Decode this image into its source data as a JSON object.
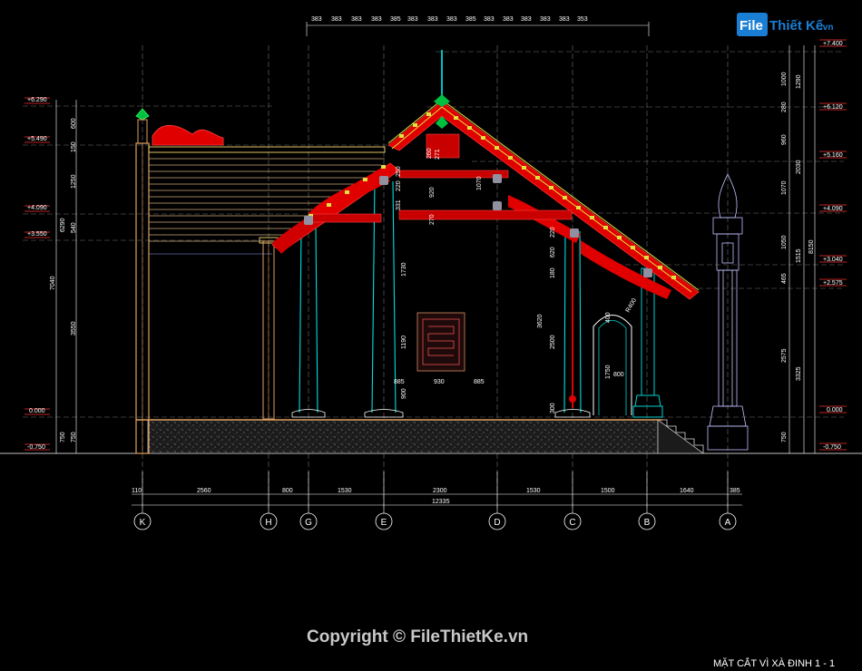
{
  "watermark": {
    "copyright": "Copyright © FileThietKe.vn",
    "logo_file": "File",
    "logo_rest": "Thiết Kế",
    "logo_domain": ".vn"
  },
  "drawing_title": "MẶT CẮT VÌ XÀ ĐINH 1 - 1",
  "top_dims": [
    "383",
    "383",
    "383",
    "383",
    "385",
    "383",
    "383",
    "383",
    "385",
    "383",
    "383",
    "383",
    "383",
    "383",
    "353"
  ],
  "left_levels": [
    "+6.290",
    "+5.490",
    "+4.090",
    "+3.550",
    "0.000",
    "-0.750"
  ],
  "right_levels": [
    "+7.400",
    "+6.120",
    "+5.160",
    "+4.090",
    "+3.040",
    "+2.575",
    "0.000",
    "-0.750"
  ],
  "left_dims_inner": [
    "600",
    "150",
    "1250",
    "540",
    "3550",
    "750"
  ],
  "left_dims_outer": [
    "6290",
    "7040",
    "750"
  ],
  "right_dims_inner": [
    "1000",
    "280",
    "960",
    "1070",
    "1050",
    "465",
    "2575",
    "750"
  ],
  "right_dims_outer": [
    "1290",
    "2030",
    "1515",
    "3325",
    "8150"
  ],
  "interior_dims": [
    "331",
    "220",
    "250",
    "260",
    "920",
    "271",
    "1070",
    "270",
    "1730",
    "1190",
    "885",
    "930",
    "885",
    "900",
    "620",
    "180",
    "220",
    "3620",
    "2500",
    "300",
    "400",
    "R400",
    "1750",
    "800"
  ],
  "bottom_dims": [
    "110",
    "2560",
    "800",
    "1530",
    "2300",
    "1530",
    "1500",
    "1640",
    "385"
  ],
  "bottom_total": "12335",
  "axes": [
    "K",
    "H",
    "G",
    "E",
    "D",
    "C",
    "B",
    "A"
  ]
}
